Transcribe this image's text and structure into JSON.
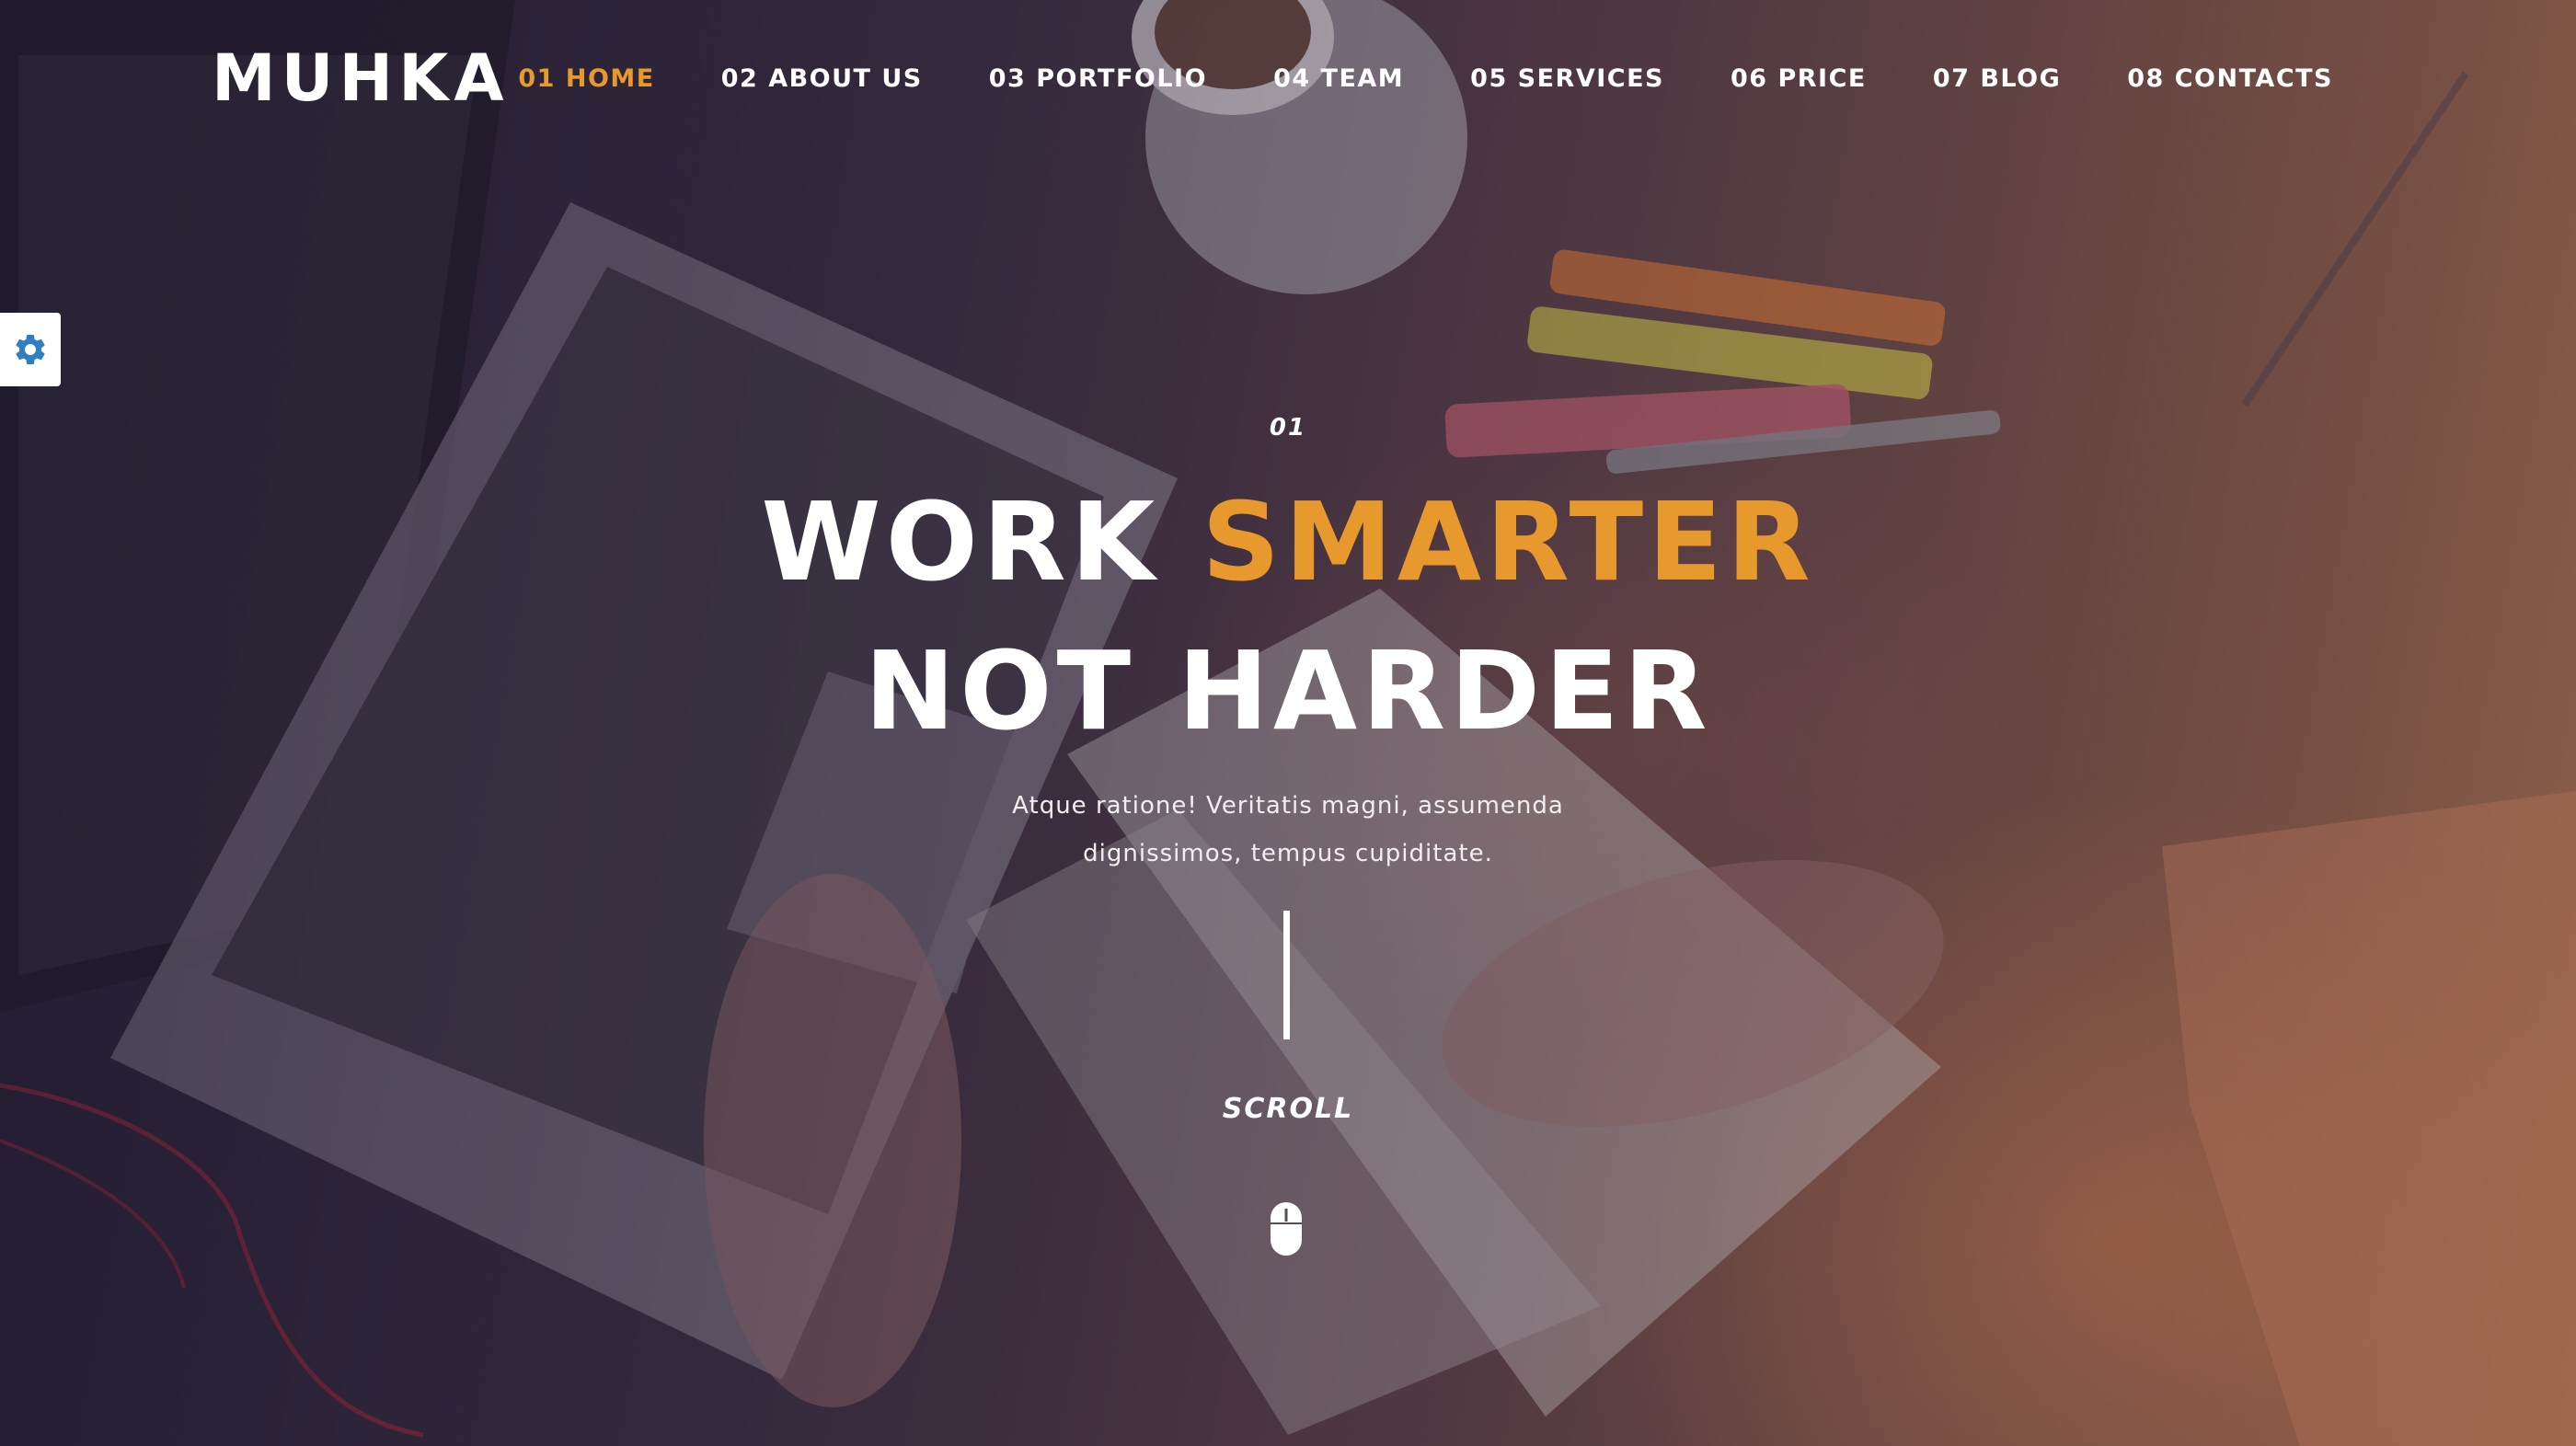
{
  "brand": {
    "logo": "MUHKA"
  },
  "nav": {
    "items": [
      {
        "label": "01 HOME",
        "active": true
      },
      {
        "label": "02 ABOUT US",
        "active": false
      },
      {
        "label": "03 PORTFOLIO",
        "active": false
      },
      {
        "label": "04 TEAM",
        "active": false
      },
      {
        "label": "05 SERVICES",
        "active": false
      },
      {
        "label": "06 PRICE",
        "active": false
      },
      {
        "label": "07 BLOG",
        "active": false
      },
      {
        "label": "08 CONTACTS",
        "active": false
      }
    ]
  },
  "settings": {
    "icon": "gear-icon",
    "color": "#2f7fc1"
  },
  "hero": {
    "index": "01",
    "title_part1": "WORK",
    "title_accent": "SMARTER",
    "title_line2": "NOT HARDER",
    "subtitle_line1": "Atque ratione! Veritatis magni, assumenda",
    "subtitle_line2": "dignissimos, tempus cupiditate.",
    "scroll_label": "SCROLL",
    "scroll_icon": "mouse-icon"
  },
  "colors": {
    "accent": "#e8992e",
    "text": "#ffffff"
  }
}
